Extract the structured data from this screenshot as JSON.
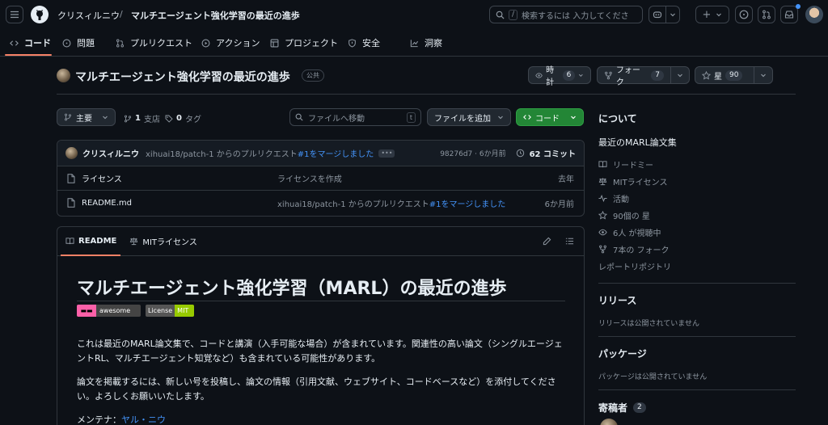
{
  "header": {
    "owner": "クリスィルニウ",
    "separator": "/",
    "repo": "マルチエージェント強化学習の最近の進歩",
    "search_key": "/",
    "search_placeholder": "検索するには 入力してくださ",
    "plus_label": "+"
  },
  "nav": {
    "items": [
      {
        "label": "コード",
        "icon": "code-icon"
      },
      {
        "label": "問題",
        "icon": "issue-icon"
      },
      {
        "label": "プルリクエスト",
        "icon": "pull-request-icon"
      },
      {
        "label": "アクション",
        "icon": "play-icon"
      },
      {
        "label": "プロジェクト",
        "icon": "table-icon"
      },
      {
        "label": "安全",
        "icon": "shield-icon"
      },
      {
        "label": "洞察",
        "icon": "graph-icon"
      }
    ]
  },
  "repo": {
    "title": "マルチエージェント強化学習の最近の進歩",
    "visibility": "公共",
    "watch_label": "時計",
    "watch_count": "6",
    "fork_label": "フォーク",
    "fork_count": "7",
    "star_label": "星",
    "star_count": "90"
  },
  "browser": {
    "branch": "主要",
    "branches_count": "1",
    "branches_label": "支店",
    "tags_count": "0",
    "tags_label": "タグ",
    "file_search_placeholder": "ファイルへ移動",
    "file_search_key": "t",
    "add_file_label": "ファイルを追加",
    "code_label": "コード"
  },
  "commit": {
    "author": "クリスィルニウ",
    "message_prefix": "xihuai18/patch-1 からのプルリクエスト",
    "message_link": "#1をマージしました",
    "hash_time": "98276d7 · 6か月前",
    "commit_count": "62 コミット"
  },
  "files": [
    {
      "name": "ライセンス",
      "message": "ライセンスを作成",
      "link": "",
      "date": "去年"
    },
    {
      "name": "README.md",
      "message": "xihuai18/patch-1 からのプルリクエスト",
      "link": "#1をマージしました",
      "date": "6か月前"
    }
  ],
  "readme": {
    "tab_readme": "README",
    "tab_license": "MITライセンス",
    "heading": "マルチエージェント強化学習（MARL）の最近の進歩",
    "badge_awesome": "awesome",
    "badge_license_left": "License",
    "badge_license_right": "MIT",
    "para1": "これは最近のMARL論文集で、コードと講演（入手可能な場合）が含まれています。関連性の高い論文（シングルエージェントRL、マルチエージェント知覚など）も含まれている可能性があります。",
    "para2": "論文を掲載するには、新しい号を投稿し、論文の情報（引用文献、ウェブサイト、コードベースなど）を添付してください。よろしくお願いいたします。",
    "maintainer_label": "メンテナ：",
    "maintainer_name": "ヤル・ニウ"
  },
  "sidebar": {
    "about_title": "について",
    "description": "最近のMARL論文集",
    "items": [
      {
        "label": "リードミー",
        "icon": "book-icon"
      },
      {
        "label": "MITライセンス",
        "icon": "law-icon"
      },
      {
        "label": "活動",
        "icon": "pulse-icon"
      },
      {
        "label": "90個の 星",
        "icon": "star-icon"
      },
      {
        "label": "6人 が視聴中",
        "icon": "eye-icon"
      },
      {
        "label": "7本の フォーク",
        "icon": "fork-icon"
      }
    ],
    "report_label": "レポートリポジトリ",
    "releases_title": "リリース",
    "releases_text": "リリースは公開されていません",
    "packages_title": "パッケージ",
    "packages_text": "パッケージは公開されていません",
    "contributors_title": "寄稿者",
    "contributors_count": "2"
  }
}
